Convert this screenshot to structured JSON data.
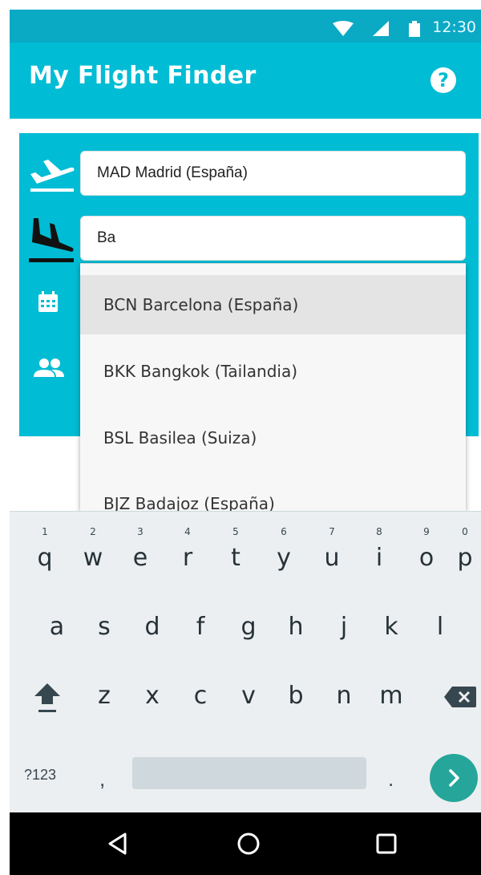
{
  "status_bar": {
    "time": "12:30",
    "color": "#0aa9c4"
  },
  "app_bar": {
    "title": "My Flight Finder",
    "help_icon": "help-circle-icon",
    "help_glyph": "?",
    "color": "#00bcd4"
  },
  "form": {
    "origin": {
      "icon": "takeoff-icon",
      "value": "MAD Madrid (España)"
    },
    "destination": {
      "icon": "landing-icon",
      "value": "Ba"
    },
    "date": {
      "icon": "calendar-icon",
      "value": ""
    },
    "passengers": {
      "icon": "people-icon",
      "value": ""
    }
  },
  "dropdown": {
    "options": [
      {
        "label": "BCN Barcelona (España)",
        "selected": true
      },
      {
        "label": "BKK Bangkok (Tailandia)",
        "selected": false
      },
      {
        "label": "BSL Basilea (Suiza)",
        "selected": false
      },
      {
        "label": "BJZ Badajoz (España)",
        "selected": false
      }
    ]
  },
  "keyboard": {
    "row1": [
      {
        "k": "q",
        "h": "1"
      },
      {
        "k": "w",
        "h": "2"
      },
      {
        "k": "e",
        "h": "3"
      },
      {
        "k": "r",
        "h": "4"
      },
      {
        "k": "t",
        "h": "5"
      },
      {
        "k": "y",
        "h": "6"
      },
      {
        "k": "u",
        "h": "7"
      },
      {
        "k": "i",
        "h": "8"
      },
      {
        "k": "o",
        "h": "9"
      },
      {
        "k": "p",
        "h": "0"
      }
    ],
    "row2": [
      "a",
      "s",
      "d",
      "f",
      "g",
      "h",
      "j",
      "k",
      "l"
    ],
    "row3": [
      "z",
      "x",
      "c",
      "v",
      "b",
      "n",
      "m"
    ],
    "symbols_label": "?123",
    "comma": ",",
    "period": ".",
    "go_color": "#26a69a"
  },
  "nav_bar": {
    "back_icon": "back-triangle-icon",
    "home_icon": "home-circle-icon",
    "recents_icon": "recents-square-icon"
  }
}
